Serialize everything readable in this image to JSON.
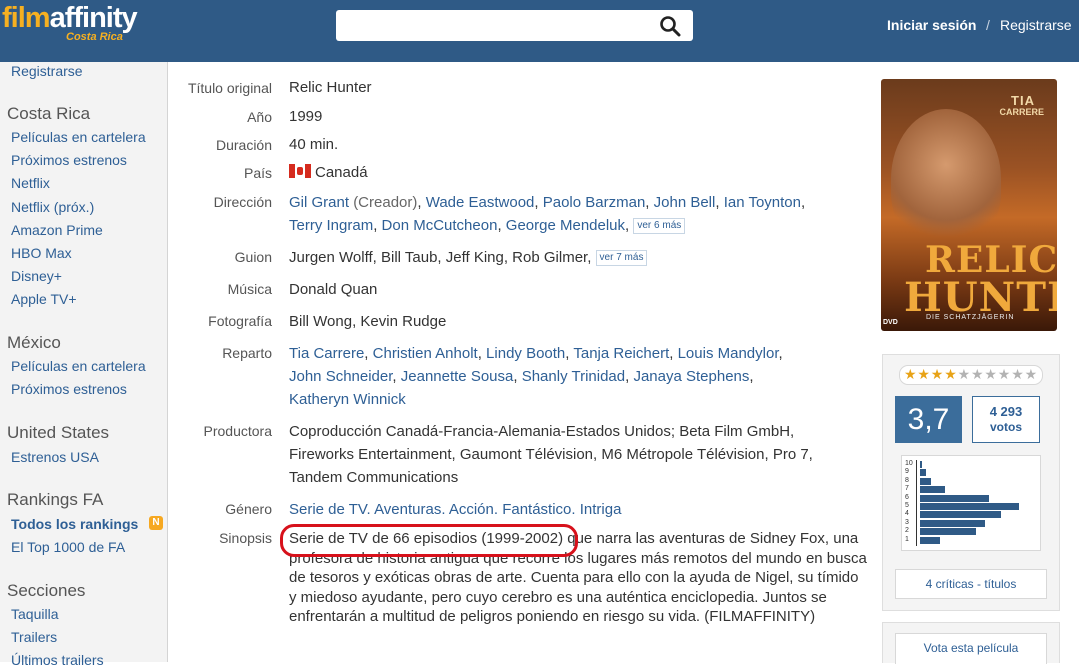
{
  "header": {
    "logo_film": "film",
    "logo_affinity": "affinity",
    "logo_region": "Costa Rica",
    "login": "Iniciar sesión",
    "separator": "/",
    "register": "Registrarse",
    "search_value": ""
  },
  "sidebar": {
    "top_link": "Registrarse",
    "costa_rica": {
      "heading": "Costa Rica",
      "items": [
        "Películas en cartelera",
        "Próximos estrenos",
        "Netflix",
        "Netflix (próx.)",
        "Amazon Prime",
        "HBO Max",
        "Disney+",
        "Apple TV+"
      ]
    },
    "mexico": {
      "heading": "México",
      "items": [
        "Películas en cartelera",
        "Próximos estrenos"
      ]
    },
    "usa": {
      "heading": "United States",
      "items": [
        "Estrenos USA"
      ]
    },
    "rankings": {
      "heading": "Rankings FA",
      "items": [
        "Todos los rankings",
        "El Top 1000 de FA"
      ],
      "badge": "N"
    },
    "secciones": {
      "heading": "Secciones",
      "items": [
        "Taquilla",
        "Trailers",
        "Últimos trailers"
      ]
    }
  },
  "movie": {
    "labels": {
      "original_title": "Título original",
      "year": "Año",
      "duration": "Duración",
      "country": "País",
      "direction": "Dirección",
      "script": "Guion",
      "music": "Música",
      "photography": "Fotografía",
      "cast": "Reparto",
      "producer": "Productora",
      "genre": "Género",
      "synopsis": "Sinopsis"
    },
    "original_title": "Relic Hunter",
    "year": "1999",
    "duration": "40 min.",
    "country": "Canadá",
    "direction": {
      "line1": [
        "Gil Grant",
        "Wade Eastwood",
        "Paolo Barzman",
        "John Bell",
        "Ian Toynton"
      ],
      "creator_note": "(Creador)",
      "line2": [
        "Terry Ingram",
        "Don McCutcheon",
        "George Mendeluk"
      ],
      "more": "ver 6 más"
    },
    "script": {
      "text": "Jurgen Wolff, Bill Taub, Jeff King, Rob Gilmer,",
      "more": "ver 7 más"
    },
    "music": "Donald Quan",
    "photography": "Bill Wong, Kevin Rudge",
    "cast": {
      "line1": [
        "Tia Carrere",
        "Christien Anholt",
        "Lindy Booth",
        "Tanja Reichert",
        "Louis Mandylor"
      ],
      "line2": [
        "John Schneider",
        "Jeannette Sousa",
        "Shanly Trinidad",
        "Janaya Stephens"
      ],
      "line3": [
        "Katheryn Winnick"
      ]
    },
    "producer": {
      "line1": "Coproducción Canadá-Francia-Alemania-Estados Unidos; Beta Film GmbH,",
      "line2": "Fireworks Entertainment, Gaumont Télévision, M6 Métropole Télévision, Pro 7,",
      "line3": "Tandem Communications"
    },
    "genre": "Serie de TV. Aventuras. Acción. Fantástico. Intriga",
    "synopsis": {
      "highlighted": "Serie de TV de 66 episodios (1999-2002)",
      "rest": " que narra las aventuras de Sidney Fox, una profesora de historia antigua que recorre los lugares más remotos del mundo en busca de tesoros y exóticas obras de arte. Cuenta para ello con la ayuda de Nigel, su tímido y miedoso ayudante, pero cuyo cerebro es una auténtica enciclopedia. Juntos se enfrentarán a multitud de peligros poniendo en riesgo su vida. (FILMAFFINITY)"
    }
  },
  "poster": {
    "actor": "TIA",
    "actor2": "CARRERE",
    "title1": "RELIC",
    "title2": "HUNTER",
    "subtitle": "DIE SCHATZJÄGERIN",
    "dvd": "DVD"
  },
  "rating": {
    "average": "3,7",
    "stars_filled": 4,
    "stars_total": 10,
    "votes_count": "4 293",
    "votes_label": "votos",
    "histogram_ticks": [
      "10",
      "9",
      "8",
      "7",
      "6",
      "5",
      "4",
      "3",
      "2",
      "1"
    ],
    "histogram_fraction": [
      0.02,
      0.05,
      0.1,
      0.22,
      0.62,
      0.88,
      0.72,
      0.58,
      0.5,
      0.18
    ],
    "reviews_link": "4 críticas - títulos",
    "vote_button": "Vota esta película"
  },
  "colors": {
    "header_bg": "#2f5a86",
    "link": "#2e5f95",
    "highlight": "#d7111b",
    "logo_accent": "#f6b021"
  }
}
